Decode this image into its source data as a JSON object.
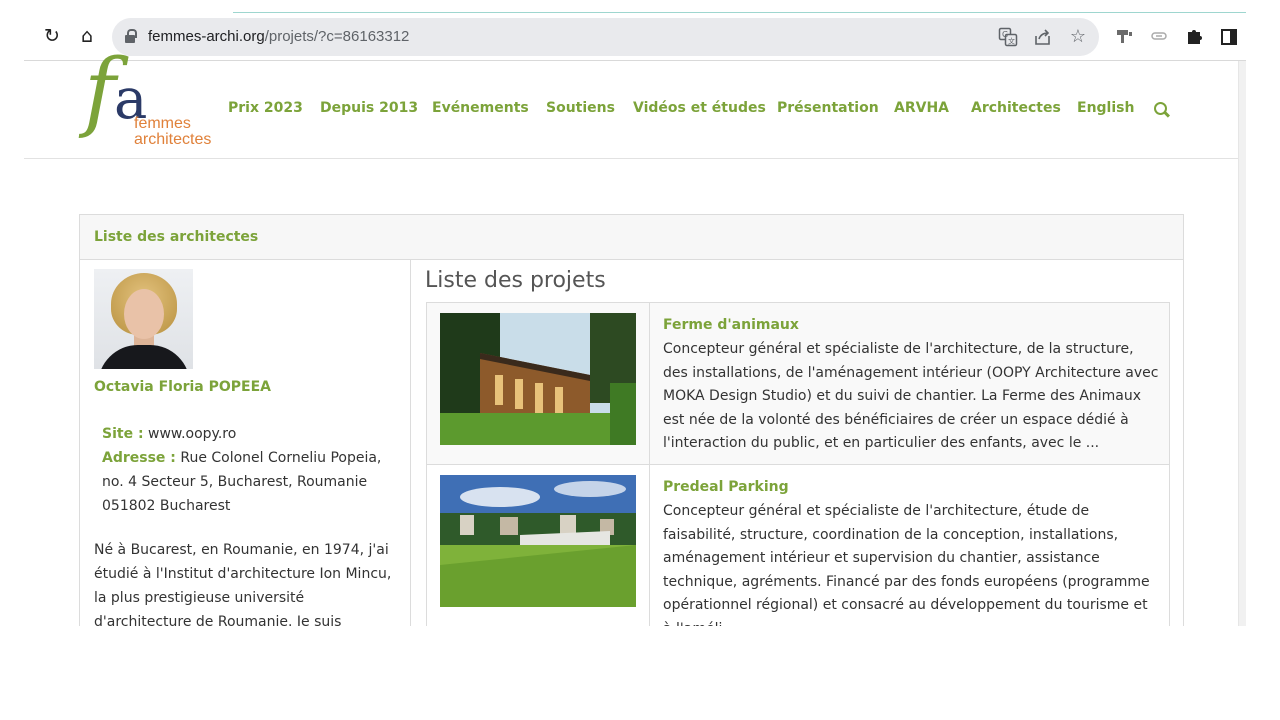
{
  "browser": {
    "url_host": "femmes-archi.org",
    "url_path": "/projets/?c=86163312",
    "icons": [
      "reload-icon",
      "home-icon",
      "lock-icon",
      "translate-icon",
      "share-icon",
      "star-icon",
      "extension-icon",
      "link-icon",
      "puzzle-icon",
      "sidepanel-icon"
    ]
  },
  "site": {
    "logo": {
      "mark_f": "f",
      "mark_a": "a",
      "word1": "femmes",
      "word2": "architectes"
    },
    "menu": [
      "Prix 2023",
      "Depuis 2013",
      "Evénements",
      "Soutiens",
      "Vidéos et études",
      "Présentation",
      "ARVHA",
      "Architectes",
      "English"
    ]
  },
  "panel": {
    "title": "Liste des architectes",
    "architect": {
      "name": "Octavia Floria POPEEA",
      "site_label": "Site :",
      "site": "www.oopy.ro",
      "address_label": "Adresse :",
      "address": "Rue Colonel Corneliu Popeia, no. 4 Secteur 5, Bucharest, Roumanie 051802 Bucharest",
      "bio": "Né à Bucarest, en Roumanie, en 1974, j'ai étudié à l'Institut d'architecture Ion Mincu, la plus prestigieuse université d'architecture de Roumanie. Je suis architecte et urbaniste."
    },
    "projects_title": "Liste des projets",
    "projects": [
      {
        "title": "Ferme d'animaux",
        "description": "Concepteur général et spécialiste de l'architecture, de la structure, des installations, de l'aménagement intérieur (OOPY Architecture avec MOKA Design Studio) et du suivi de chantier. La Ferme des Animaux est née de la volonté des bénéficiaires de créer un espace dédié à l'interaction du public, et en particulier des enfants, avec le ..."
      },
      {
        "title": "Predeal Parking",
        "description": "Concepteur général et spécialiste de l'architecture, étude de faisabilité, structure, coordination de la conception, installations, aménagement intérieur et supervision du chantier, assistance technique, agréments. Financé par des fonds européens (programme opérationnel régional) et consacré au développement du tourisme et à l'améli..."
      }
    ]
  },
  "colors": {
    "accent": "#7ca33a",
    "logo_navy": "#2b3a67",
    "logo_orange": "#e0813a"
  }
}
